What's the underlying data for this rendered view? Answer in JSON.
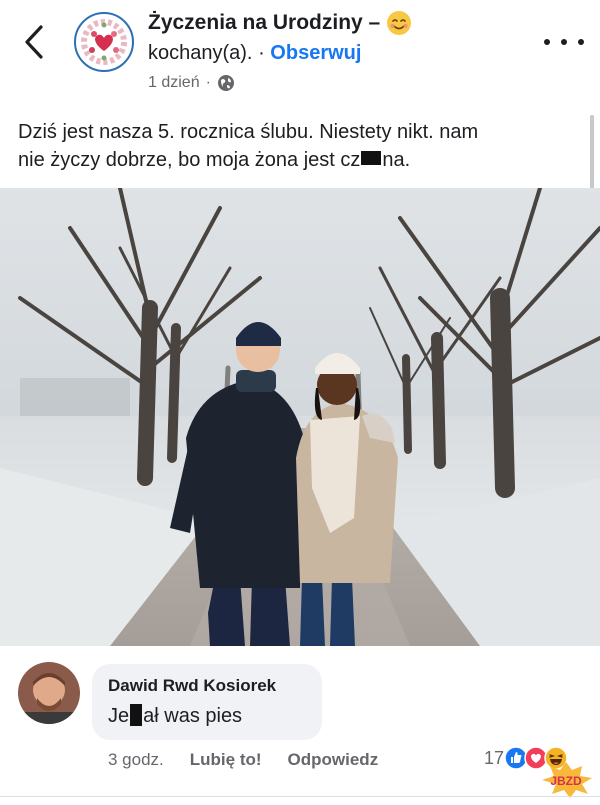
{
  "header": {
    "back_icon": "chevron-left-icon",
    "page_avatar_icon": "heart-wreath-icon",
    "title": "Życzenia na Urodziny –",
    "title_emoji": "smiling-face-with-hearts-icon",
    "subtitle_name": "kochany(a).",
    "subtitle_separator": "·",
    "follow_label": "Obserwuj",
    "time": "1 dzień",
    "meta_separator": "·",
    "privacy_icon": "globe-icon",
    "more_icon": "more-dots-icon"
  },
  "post": {
    "text_line1": "Dziś jest nasza 5. rocznica ślubu. Niestety nikt. nam",
    "text_line2_before": "nie życzy dobrze, bo moja żona jest cz",
    "text_line2_after": "na.",
    "photo_description_icon": "couple-winter-photo"
  },
  "comment": {
    "author": "Dawid Rwd Kosiorek",
    "text_before": "Je",
    "text_after": "ał was pies",
    "time": "3 godz.",
    "like_label": "Lubię to!",
    "reply_label": "Odpowiedz",
    "reaction_count": "17",
    "reaction_icons": [
      "like-icon",
      "love-icon",
      "haha-icon"
    ]
  },
  "watermark": {
    "text": "JBZD"
  },
  "colors": {
    "accent": "#1877f2",
    "muted": "#65676b",
    "bubble": "#f0f2f5"
  }
}
